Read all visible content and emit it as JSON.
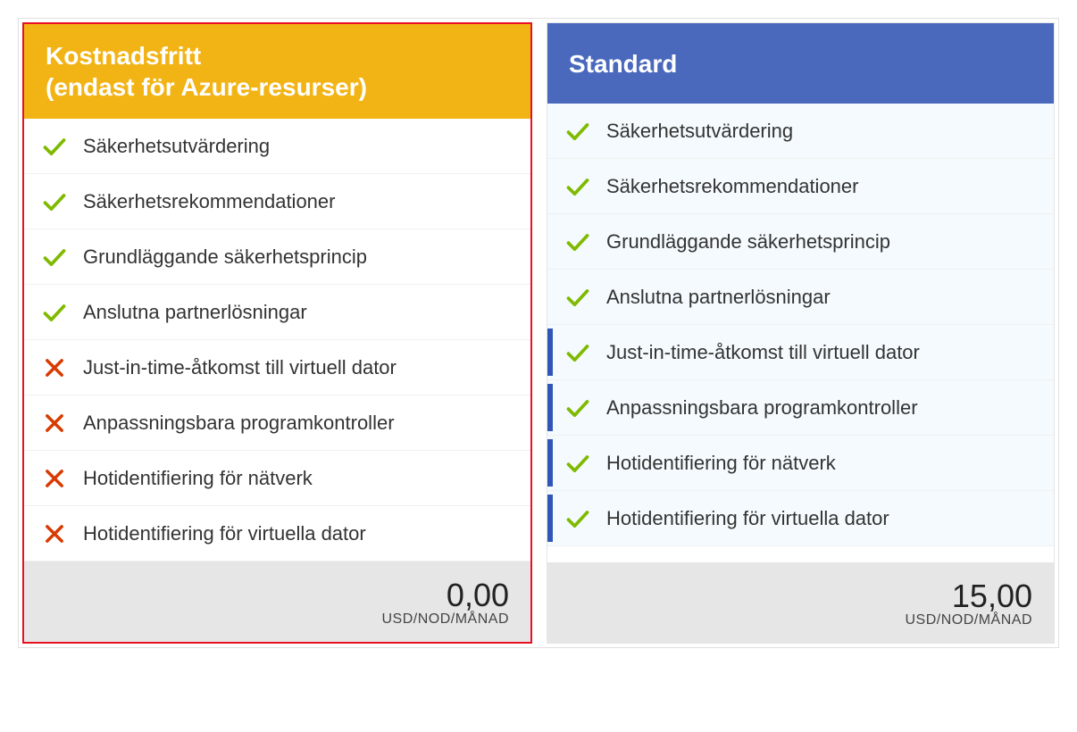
{
  "plans": {
    "free": {
      "title": "Kostnadsfritt\n(endast för Azure-resurser)",
      "features": [
        {
          "label": "Säkerhetsutvärdering",
          "included": true
        },
        {
          "label": "Säkerhetsrekommendationer",
          "included": true
        },
        {
          "label": "Grundläggande säkerhetsprincip",
          "included": true
        },
        {
          "label": "Anslutna partnerlösningar",
          "included": true
        },
        {
          "label": "Just-in-time-åtkomst till virtuell dator",
          "included": false
        },
        {
          "label": "Anpassningsbara programkontroller",
          "included": false
        },
        {
          "label": "Hotidentifiering för nätverk",
          "included": false
        },
        {
          "label": "Hotidentifiering för virtuella dator",
          "included": false
        }
      ],
      "price": "0,00",
      "unit": "USD/NOD/MÅNAD"
    },
    "standard": {
      "title": "Standard",
      "features": [
        {
          "label": "Säkerhetsutvärdering",
          "included": true,
          "highlight": false
        },
        {
          "label": "Säkerhetsrekommendationer",
          "included": true,
          "highlight": false
        },
        {
          "label": "Grundläggande säkerhetsprincip",
          "included": true,
          "highlight": false
        },
        {
          "label": "Anslutna partnerlösningar",
          "included": true,
          "highlight": false
        },
        {
          "label": "Just-in-time-åtkomst till virtuell dator",
          "included": true,
          "highlight": true
        },
        {
          "label": "Anpassningsbara programkontroller",
          "included": true,
          "highlight": true
        },
        {
          "label": "Hotidentifiering för nätverk",
          "included": true,
          "highlight": true
        },
        {
          "label": "Hotidentifiering för virtuella dator",
          "included": true,
          "highlight": true
        }
      ],
      "price": "15,00",
      "unit": "USD/NOD/MÅNAD"
    }
  },
  "colors": {
    "free_header": "#f2b314",
    "standard_header": "#4a69bd",
    "selected_border": "#e81123",
    "check": "#7fba00",
    "cross": "#d83b01"
  }
}
